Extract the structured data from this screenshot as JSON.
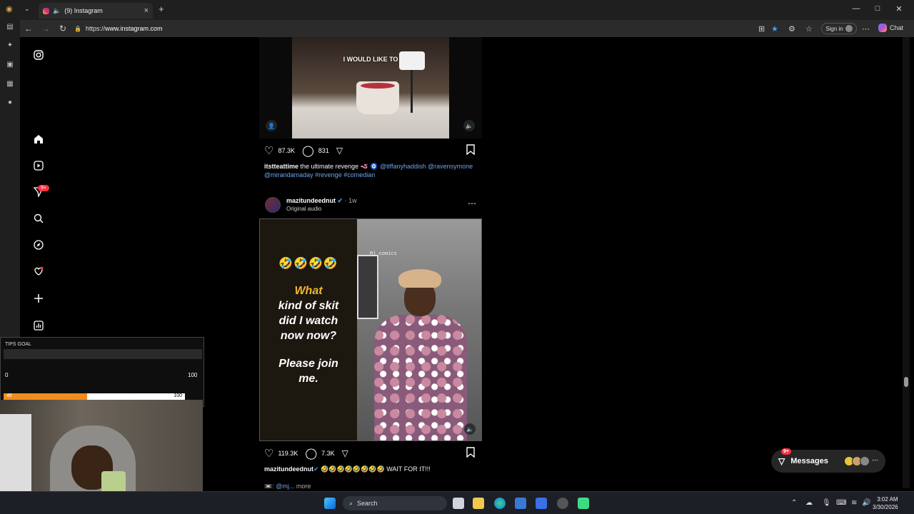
{
  "browser": {
    "tab_title": "(9) Instagram",
    "tab_close": "×",
    "new_tab": "+",
    "url_scheme": "https://",
    "url_host": "www.instagram.com",
    "signin_label": "Sign in",
    "chat_label": "Chat",
    "win_min": "—",
    "win_max": "□",
    "win_close": "✕"
  },
  "sidebar": {
    "notifications_badge": "9+"
  },
  "post1": {
    "overlay_text": "I WOULD LIKE TO",
    "likes": "87.3K",
    "comments": "831",
    "caption_author": "itstteattime",
    "caption_text": " the ultimate revenge 🪱 🧿 ",
    "caption_tags": "@tiffanyhaddish @ravensymone @mirandamaday #revenge #comedian"
  },
  "post2": {
    "author": "mazitundeednut",
    "verified": "✔",
    "time": "· 1w",
    "subline": "Original audio",
    "emoji": "🤣🤣🤣🤣",
    "line_what": "What",
    "line_rest": "kind of skit did I watch now now?",
    "line_join": "Please join me.",
    "watermark": "Mj comics",
    "likes": "119.3K",
    "comments": "7.3K",
    "caption_author": "mazitundeednut",
    "caption_text": " 🤣🤣🤣🤣🤣🤣🤣🤣 WAIT FOR IT!!!",
    "caption_more_prefix": "📼: @mj...",
    "caption_more": "more"
  },
  "tips": {
    "title": "TIPS GOAL",
    "range_left": "0",
    "range_right": "100",
    "bar_left": "46",
    "bar_right": "100",
    "progress": 0.46
  },
  "messages": {
    "label": "Messages",
    "badge": "9+"
  },
  "taskbar": {
    "search_label": "Search",
    "time": "3:02 AM",
    "date": "3/30/2026"
  }
}
